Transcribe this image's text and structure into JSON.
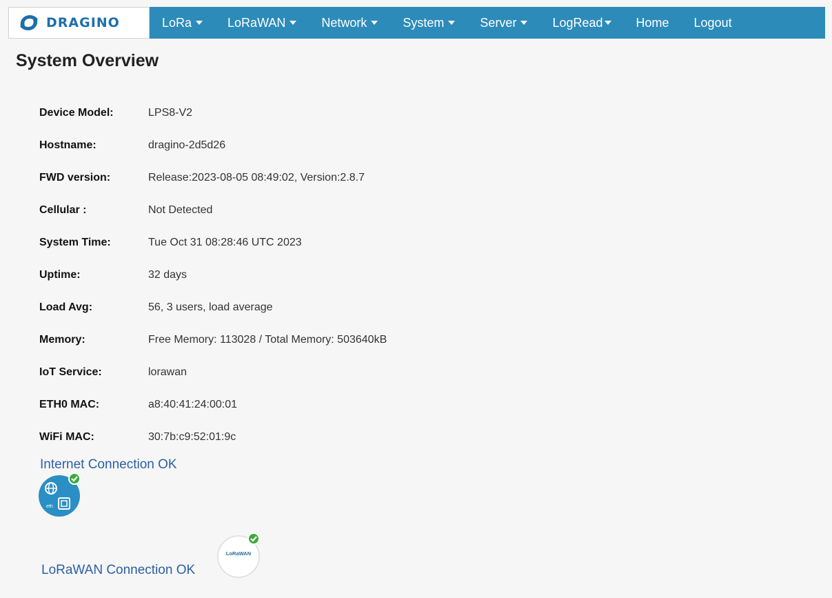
{
  "brand": {
    "name": "DRAGINO",
    "logo_icon": "dragino-logo-icon"
  },
  "nav": [
    {
      "label": "LoRa",
      "dropdown": true
    },
    {
      "label": "LoRaWAN",
      "dropdown": true
    },
    {
      "label": "Network",
      "dropdown": true
    },
    {
      "label": "System",
      "dropdown": true
    },
    {
      "label": "Server",
      "dropdown": true
    },
    {
      "label": "LogRead",
      "dropdown": true
    },
    {
      "label": "Home",
      "dropdown": false
    },
    {
      "label": "Logout",
      "dropdown": false
    }
  ],
  "page_title": "System Overview",
  "info": [
    {
      "label": "Device Model:",
      "value": "LPS8-V2"
    },
    {
      "label": "Hostname:",
      "value": "dragino-2d5d26"
    },
    {
      "label": "FWD version:",
      "value": "Release:2023-08-05 08:49:02, Version:2.8.7"
    },
    {
      "label": "Cellular :",
      "value": "Not Detected"
    },
    {
      "label": "System Time:",
      "value": "Tue Oct 31 08:28:46 UTC 2023"
    },
    {
      "label": "Uptime:",
      "value": "32 days"
    },
    {
      "label": "Load Avg:",
      "value": "56, 3 users, load average"
    },
    {
      "label": "Memory:",
      "value": "Free Memory: 113028 / Total Memory: 503640kB"
    },
    {
      "label": "IoT Service:",
      "value": "lorawan"
    },
    {
      "label": "ETH0 MAC:",
      "value": "a8:40:41:24:00:01"
    },
    {
      "label": "WiFi MAC:",
      "value": "30:7b:c9:52:01:9c"
    }
  ],
  "internet_status": {
    "text": "Internet Connection OK",
    "icon": "internet-ethernet-ok-icon",
    "icon_label": "eth"
  },
  "lorawan_status": {
    "text": "LoRaWAN Connection OK",
    "icon": "lorawan-ok-icon",
    "icon_label": "LoRaWAN"
  },
  "colors": {
    "nav": "#2d8bb9",
    "status_link": "#2b5fa5",
    "ok_badge": "#3aab3a",
    "internet_icon": "#2a8fc4"
  }
}
